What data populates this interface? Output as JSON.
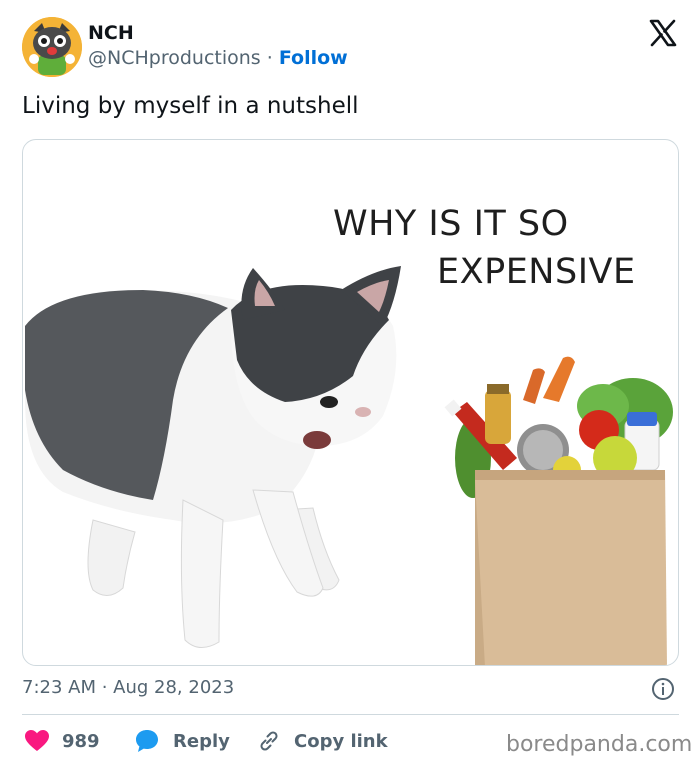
{
  "tweet": {
    "author_name": "NCH",
    "author_handle": "@NCHproductions",
    "separator": "·",
    "follow_label": "Follow",
    "text": "Living by myself in a nutshell",
    "timestamp": "7:23 AM · Aug 28, 2023"
  },
  "media": {
    "caption_line1": "WHY IS IT SO",
    "caption_line2": "EXPENSIVE"
  },
  "actions": {
    "like_count": "989",
    "reply_label": "Reply",
    "copy_link_label": "Copy link"
  },
  "watermark": "boredpanda.com",
  "colors": {
    "like": "#f91880",
    "reply": "#1d9bf0",
    "follow": "#006fd6",
    "secondary_text": "#536471"
  },
  "icons": {
    "brand": "x-logo-icon",
    "info": "info-icon",
    "like": "heart-icon",
    "reply": "speech-bubble-icon",
    "copy": "link-icon"
  }
}
